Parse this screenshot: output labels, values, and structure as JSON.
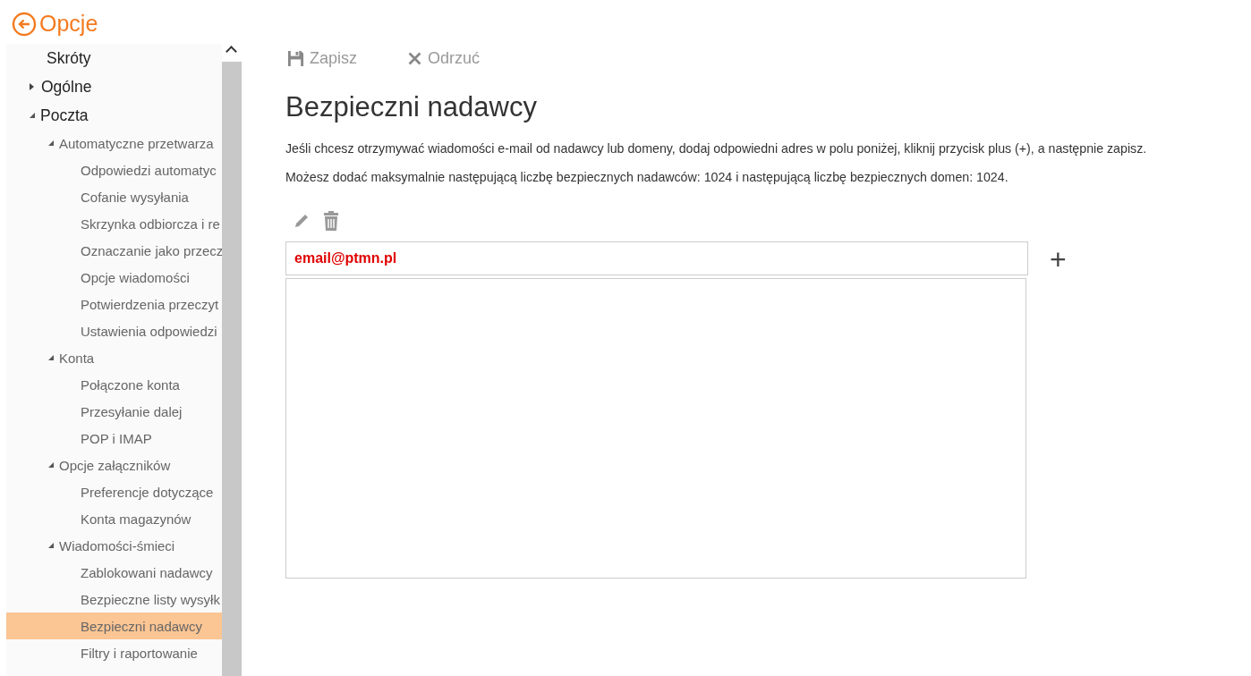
{
  "header": {
    "title": "Opcje"
  },
  "sidebar": {
    "items": [
      {
        "label": "Skróty",
        "selected": false
      },
      {
        "label": "Ogólne",
        "expanded": false,
        "selected": false
      },
      {
        "label": "Poczta",
        "expanded": true,
        "selected": false,
        "children": [
          {
            "label": "Automatyczne przetwarza",
            "expanded": true,
            "selected": false,
            "children": [
              {
                "label": "Odpowiedzi automatyc",
                "selected": false
              },
              {
                "label": "Cofanie wysyłania",
                "selected": false
              },
              {
                "label": "Skrzynka odbiorcza i re",
                "selected": false
              },
              {
                "label": "Oznaczanie jako przecz",
                "selected": false
              },
              {
                "label": "Opcje wiadomości",
                "selected": false
              },
              {
                "label": "Potwierdzenia przeczyt",
                "selected": false
              },
              {
                "label": "Ustawienia odpowiedzi",
                "selected": false
              }
            ]
          },
          {
            "label": "Konta",
            "expanded": true,
            "selected": false,
            "children": [
              {
                "label": "Połączone konta",
                "selected": false
              },
              {
                "label": "Przesyłanie dalej",
                "selected": false
              },
              {
                "label": "POP i IMAP",
                "selected": false
              }
            ]
          },
          {
            "label": "Opcje załączników",
            "expanded": true,
            "selected": false,
            "children": [
              {
                "label": "Preferencje dotyczące",
                "selected": false
              },
              {
                "label": "Konta magazynów",
                "selected": false
              }
            ]
          },
          {
            "label": "Wiadomości-śmieci",
            "expanded": true,
            "selected": false,
            "children": [
              {
                "label": "Zablokowani nadawcy",
                "selected": false
              },
              {
                "label": "Bezpieczne listy wysyłk",
                "selected": false
              },
              {
                "label": "Bezpieczni nadawcy",
                "selected": true
              },
              {
                "label": "Filtry i raportowanie",
                "selected": false
              }
            ]
          }
        ]
      }
    ]
  },
  "toolbar": {
    "buttons": [
      {
        "kind": "save",
        "label": "Zapisz"
      },
      {
        "kind": "discard",
        "label": "Odrzuć"
      }
    ]
  },
  "page": {
    "title": "Bezpieczni nadawcy",
    "paragraphs": [
      "Jeśli chcesz otrzymywać wiadomości e-mail od nadawcy lub domeny, dodaj odpowiedni adres w polu poniżej, kliknij przycisk plus (+), a następnie zapisz.",
      "Możesz dodać maksymalnie następującą liczbę bezpiecznych nadawców: 1024 i następującą liczbę bezpiecznych domen: 1024."
    ],
    "list_tools": [
      {
        "kind": "edit"
      },
      {
        "kind": "delete"
      }
    ],
    "address_input": {
      "value": "email@ptmn.pl"
    },
    "add_button": {
      "label": "+"
    }
  }
}
